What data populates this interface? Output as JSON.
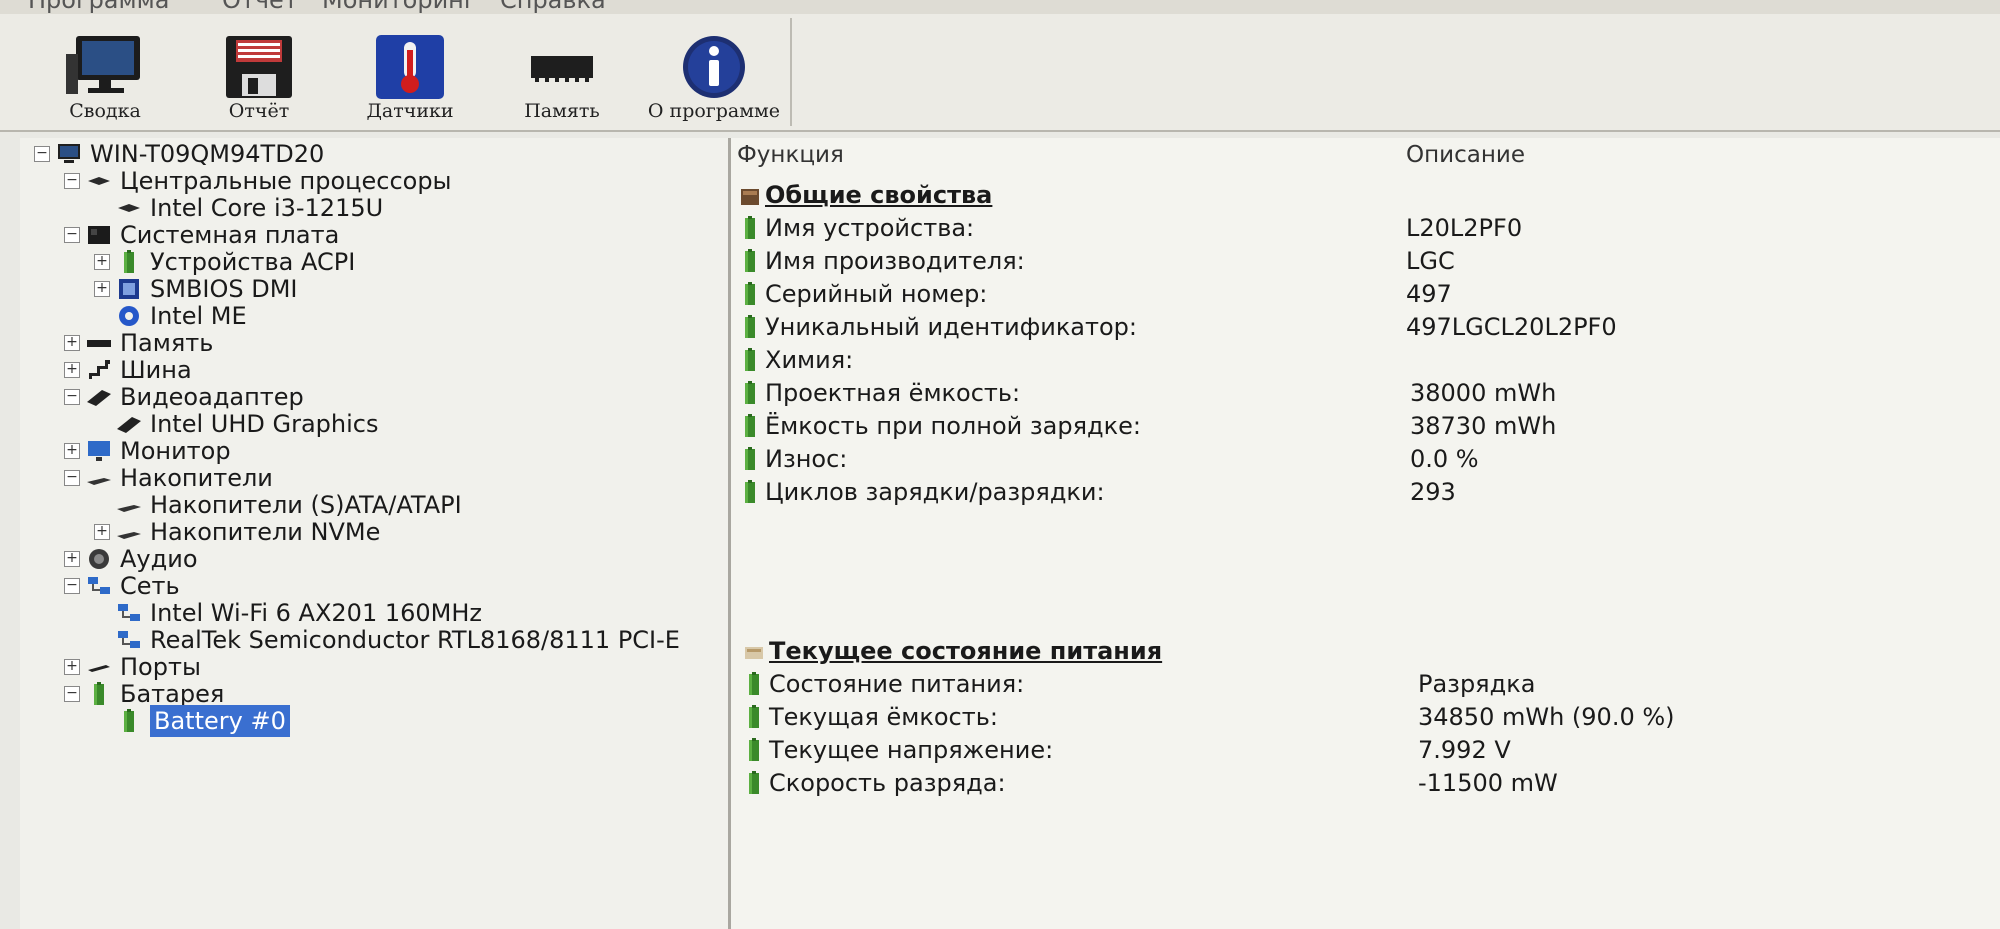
{
  "menu": [
    "Программа",
    "Отчёт",
    "Мониторинг",
    "Справка"
  ],
  "toolbar": [
    {
      "label": "Сводка",
      "icon": "monitor-icon"
    },
    {
      "label": "Отчёт",
      "icon": "floppy-icon"
    },
    {
      "label": "Датчики",
      "icon": "thermometer-icon"
    },
    {
      "label": "Память",
      "icon": "memory-icon"
    },
    {
      "label": "О программе",
      "icon": "info-icon"
    }
  ],
  "tree": [
    {
      "label": "WIN-T09QM94TD20",
      "level": 0,
      "expander": "minus",
      "icon": "computer-icon"
    },
    {
      "label": "Центральные процессоры",
      "level": 1,
      "expander": "minus",
      "icon": "cpu-icon"
    },
    {
      "label": "Intel Core i3-1215U",
      "level": 2,
      "expander": "",
      "icon": "cpu-icon"
    },
    {
      "label": "Системная плата",
      "level": 1,
      "expander": "minus",
      "icon": "motherboard-icon"
    },
    {
      "label": "Устройства ACPI",
      "level": 2,
      "expander": "plus",
      "icon": "battery-icon"
    },
    {
      "label": "SMBIOS DMI",
      "level": 2,
      "expander": "plus",
      "icon": "chip-icon"
    },
    {
      "label": "Intel ME",
      "level": 2,
      "expander": "",
      "icon": "gear-icon"
    },
    {
      "label": "Память",
      "level": 1,
      "expander": "plus",
      "icon": "memory-icon"
    },
    {
      "label": "Шина",
      "level": 1,
      "expander": "plus",
      "icon": "bus-icon"
    },
    {
      "label": "Видеоадаптер",
      "level": 1,
      "expander": "minus",
      "icon": "gpu-icon"
    },
    {
      "label": "Intel UHD Graphics",
      "level": 2,
      "expander": "",
      "icon": "gpu-icon"
    },
    {
      "label": "Монитор",
      "level": 1,
      "expander": "plus",
      "icon": "monitor-icon"
    },
    {
      "label": "Накопители",
      "level": 1,
      "expander": "minus",
      "icon": "drive-icon"
    },
    {
      "label": "Накопители (S)ATA/ATAPI",
      "level": 2,
      "expander": "",
      "icon": "drive-icon"
    },
    {
      "label": "Накопители NVMe",
      "level": 2,
      "expander": "plus",
      "icon": "drive-icon"
    },
    {
      "label": "Аудио",
      "level": 1,
      "expander": "plus",
      "icon": "speaker-icon"
    },
    {
      "label": "Сеть",
      "level": 1,
      "expander": "minus",
      "icon": "network-icon"
    },
    {
      "label": "Intel Wi-Fi 6 AX201 160MHz",
      "level": 2,
      "expander": "",
      "icon": "network-icon"
    },
    {
      "label": "RealTek Semiconductor RTL8168/8111 PCI-E",
      "level": 2,
      "expander": "",
      "icon": "network-icon"
    },
    {
      "label": "Порты",
      "level": 1,
      "expander": "plus",
      "icon": "port-icon"
    },
    {
      "label": "Батарея",
      "level": 1,
      "expander": "minus",
      "icon": "battery-icon"
    },
    {
      "label": "Battery #0",
      "level": 2,
      "expander": "",
      "icon": "battery-icon",
      "selected": true
    }
  ],
  "columns": {
    "function": "Функция",
    "description": "Описание"
  },
  "sections": [
    {
      "title": "Общие свойства",
      "rows": [
        {
          "label": "Имя устройства:",
          "value": "L20L2PF0"
        },
        {
          "label": "Имя производителя:",
          "value": "LGC"
        },
        {
          "label": "Серийный номер:",
          "value": "497"
        },
        {
          "label": "Уникальный идентификатор:",
          "value": "497LGCL20L2PF0"
        },
        {
          "label": "Химия:",
          "value": ""
        },
        {
          "label": "Проектная ёмкость:",
          "value": "38000 mWh"
        },
        {
          "label": "Ёмкость при полной зарядке:",
          "value": "38730 mWh"
        },
        {
          "label": "Износ:",
          "value": "0.0 %"
        },
        {
          "label": "Циклов зарядки/разрядки:",
          "value": "293"
        }
      ]
    },
    {
      "title": "Текущее состояние питания",
      "rows": [
        {
          "label": "Состояние питания:",
          "value": "Разрядка"
        },
        {
          "label": "Текущая ёмкость:",
          "value": "34850 mWh (90.0 %)"
        },
        {
          "label": "Текущее напряжение:",
          "value": "7.992 V"
        },
        {
          "label": "Скорость разряда:",
          "value": "-11500 mW"
        }
      ]
    }
  ],
  "colors": {
    "accent": "#3a6fd0",
    "battery_green": "#3a8a2a",
    "section_icon": "#6b4a2e"
  }
}
